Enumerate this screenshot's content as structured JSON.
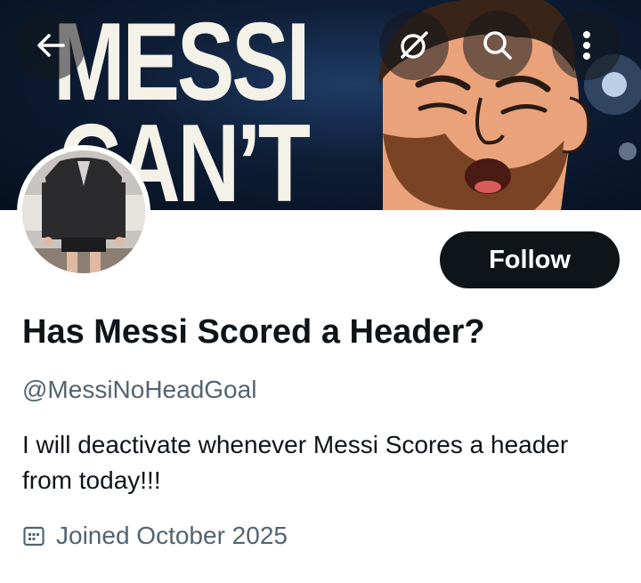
{
  "banner": {
    "line1": "MESSI",
    "line2": "CAN’T"
  },
  "header": {
    "back_icon": "back-arrow-icon",
    "grok_icon": "grok-icon",
    "search_icon": "search-icon",
    "more_icon": "more-vertical-icon"
  },
  "profile": {
    "display_name": "Has Messi Scored a Header?",
    "handle": "@MessiNoHeadGoal",
    "bio": "I will deactivate whenever Messi Scores a header from today!!!",
    "joined": "Joined October 2025",
    "follow_label": "Follow"
  },
  "colors": {
    "text_primary": "#0f1419",
    "text_secondary": "#536471",
    "button_bg": "#0f1419",
    "button_text": "#ffffff"
  }
}
